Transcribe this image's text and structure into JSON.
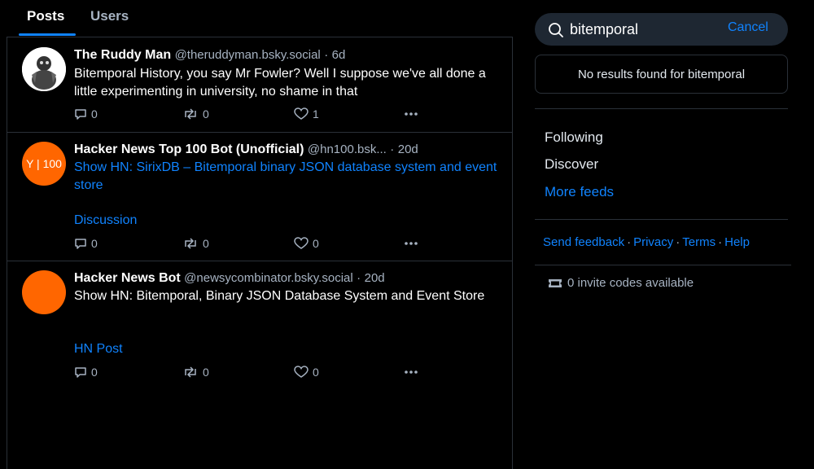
{
  "tabs": [
    {
      "label": "Posts"
    },
    {
      "label": "Users"
    }
  ],
  "posts": [
    {
      "author": "The Ruddy Man",
      "handle": "@theruddyman.bsky.social",
      "time": "6d",
      "text": "Bitemporal History, you say Mr Fowler? Well I suppose we've all done a little experimenting in university, no shame in that",
      "replies": "0",
      "reposts": "0",
      "likes": "1"
    },
    {
      "author": "Hacker News Top 100 Bot (Unofficial)",
      "handle": "@hn100.bsk...",
      "time": "20d",
      "avatar_text": "Y | 100",
      "text": "Show HN: SirixDB  – Bitemporal binary JSON database system and event store",
      "link": "Discussion",
      "replies": "0",
      "reposts": "0",
      "likes": "0"
    },
    {
      "author": "Hacker News Bot",
      "handle": "@newsycombinator.bsky.social",
      "time": "20d",
      "text": "Show HN: Bitemporal, Binary JSON Database System and Event Store",
      "link": "HN Post",
      "replies": "0",
      "reposts": "0",
      "likes": "0"
    }
  ],
  "search": {
    "query": "bitemporal",
    "cancel_label": "Cancel",
    "no_results": "No results found for bitemporal"
  },
  "feeds": [
    {
      "label": "Following"
    },
    {
      "label": "Discover"
    },
    {
      "label": "More feeds"
    }
  ],
  "footer": {
    "send_feedback": "Send feedback",
    "privacy": "Privacy",
    "terms": "Terms",
    "help": "Help",
    "separator": "·"
  },
  "invite": {
    "text": "0 invite codes available"
  },
  "colors": {
    "background": "#000000",
    "accent": "#1083fe",
    "muted": "#a7b3c2",
    "border": "#2a3038",
    "hn_orange": "#ff6600"
  }
}
